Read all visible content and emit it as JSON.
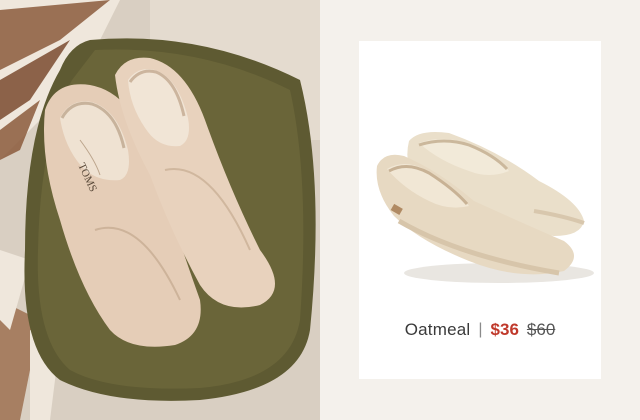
{
  "lifestyle_photo": {
    "brand_mark": "TOMS"
  },
  "product": {
    "color_name": "Oatmeal",
    "separator": "|",
    "sale_price": "$36",
    "original_price": "$60"
  },
  "colors": {
    "sale_price": "#c0392b",
    "card_background": "#ffffff",
    "page_background": "#f4f1ec"
  }
}
